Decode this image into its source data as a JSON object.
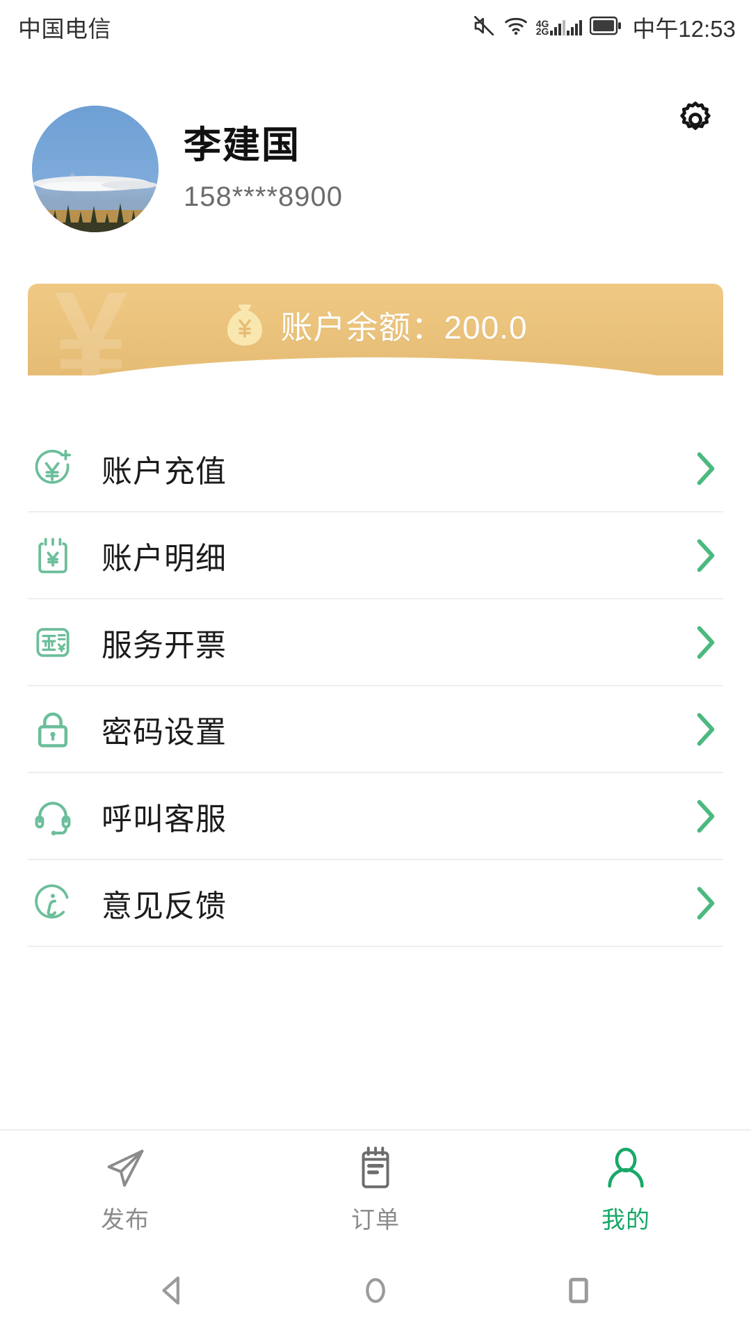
{
  "status_bar": {
    "carrier": "中国电信",
    "time": "中午12:53",
    "signal_primary": "4G",
    "signal_secondary": "2G",
    "icons": [
      "mute-icon",
      "wifi-icon",
      "signal-icon",
      "battery-icon"
    ]
  },
  "profile": {
    "name": "李建国",
    "phone": "158****8900",
    "avatar_alt": "mountain-landscape-photo",
    "settings_icon": "gear-icon"
  },
  "balance": {
    "label": "账户余额：",
    "amount": "200.0",
    "full_text": "账户余额：200.0",
    "icon": "money-bag-icon",
    "watermark": "¥",
    "colors": {
      "bg_top": "#EFC984",
      "bg_bottom": "#E6BC74",
      "text": "#FFFFFF"
    }
  },
  "menu": {
    "items": [
      {
        "label": "账户充值",
        "icon": "yuan-plus-circle-icon",
        "chevron": "chevron-right-icon"
      },
      {
        "label": "账户明细",
        "icon": "receipt-yuan-icon",
        "chevron": "chevron-right-icon"
      },
      {
        "label": "服务开票",
        "icon": "invoice-icon",
        "chevron": "chevron-right-icon"
      },
      {
        "label": "密码设置",
        "icon": "lock-icon",
        "chevron": "chevron-right-icon"
      },
      {
        "label": "呼叫客服",
        "icon": "headset-icon",
        "chevron": "chevron-right-icon"
      },
      {
        "label": "意见反馈",
        "icon": "info-circle-icon",
        "chevron": "chevron-right-icon"
      }
    ],
    "accent_color": "#4CB97F"
  },
  "tab_bar": {
    "items": [
      {
        "label": "发布",
        "icon": "paper-plane-icon",
        "active": false
      },
      {
        "label": "订单",
        "icon": "clipboard-icon",
        "active": false
      },
      {
        "label": "我的",
        "icon": "person-icon",
        "active": true
      }
    ],
    "active_color": "#18A868",
    "inactive_color": "#8B8B8B"
  },
  "android_nav": {
    "back": "back-triangle-icon",
    "home": "home-circle-icon",
    "recents": "recents-square-icon"
  }
}
